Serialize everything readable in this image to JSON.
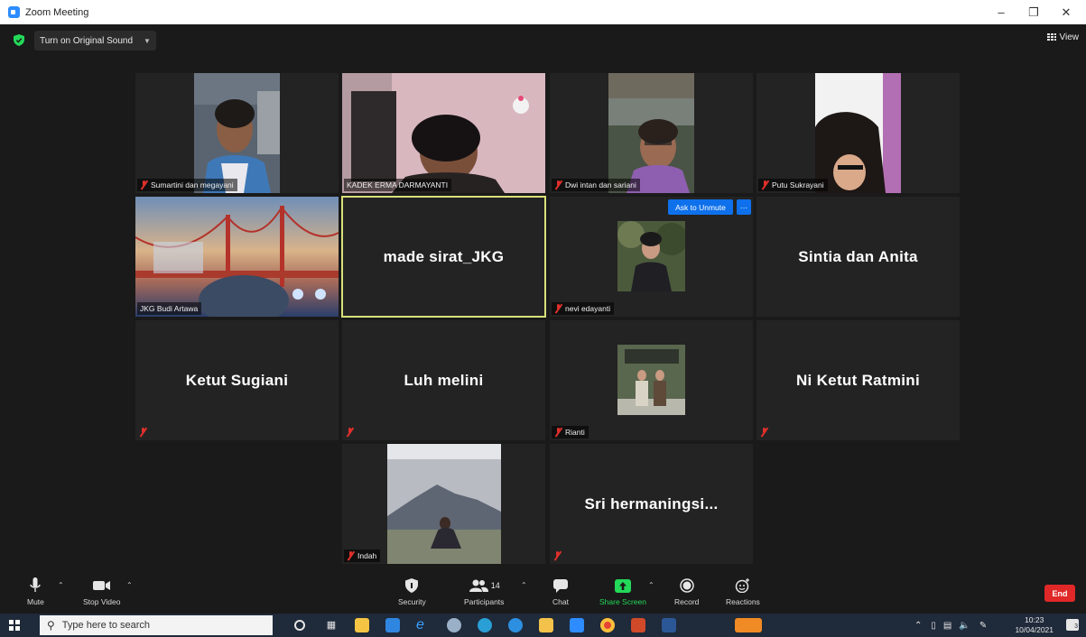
{
  "window": {
    "title": "Zoom Meeting"
  },
  "top": {
    "original_sound_label": "Turn on Original Sound",
    "view_label": "View"
  },
  "tiles": {
    "t1": {
      "name": "Sumartini dan megayani"
    },
    "t2": {
      "name": "KADEK ERMA DARMAYANTI"
    },
    "t3": {
      "name": "Dwi intan dan sariani"
    },
    "t4": {
      "name": "Putu Sukrayani"
    },
    "t5": {
      "name": "JKG Budi Artawa"
    },
    "t6": {
      "name": "made sirat_JKG"
    },
    "t7": {
      "name": "nevi edayanti",
      "ask_to_unmute": "Ask to Unmute",
      "more": "···"
    },
    "t8": {
      "name": "Sintia dan Anita"
    },
    "t9": {
      "name": "Ketut Sugiani"
    },
    "t10": {
      "name": "Luh melini"
    },
    "t11": {
      "name": "Rianti"
    },
    "t12": {
      "name": "Ni Ketut Ratmini"
    },
    "t13": {
      "name": "Indah"
    },
    "t14": {
      "name": "Sri  hermaningsi..."
    }
  },
  "toolbar": {
    "mute": "Mute",
    "stop_video": "Stop Video",
    "security": "Security",
    "participants": "Participants",
    "participants_count": "14",
    "chat": "Chat",
    "share_screen": "Share Screen",
    "record": "Record",
    "reactions": "Reactions",
    "end": "End"
  },
  "taskbar": {
    "search_placeholder": "Type here to search",
    "time": "10:23",
    "date": "10/04/2021",
    "notifications": "3"
  },
  "colors": {
    "accent_blue": "#0e71eb",
    "share_green": "#23d959",
    "end_red": "#e02828",
    "active_speaker_border": "#d8e07a",
    "muted_red": "#e0302b"
  }
}
